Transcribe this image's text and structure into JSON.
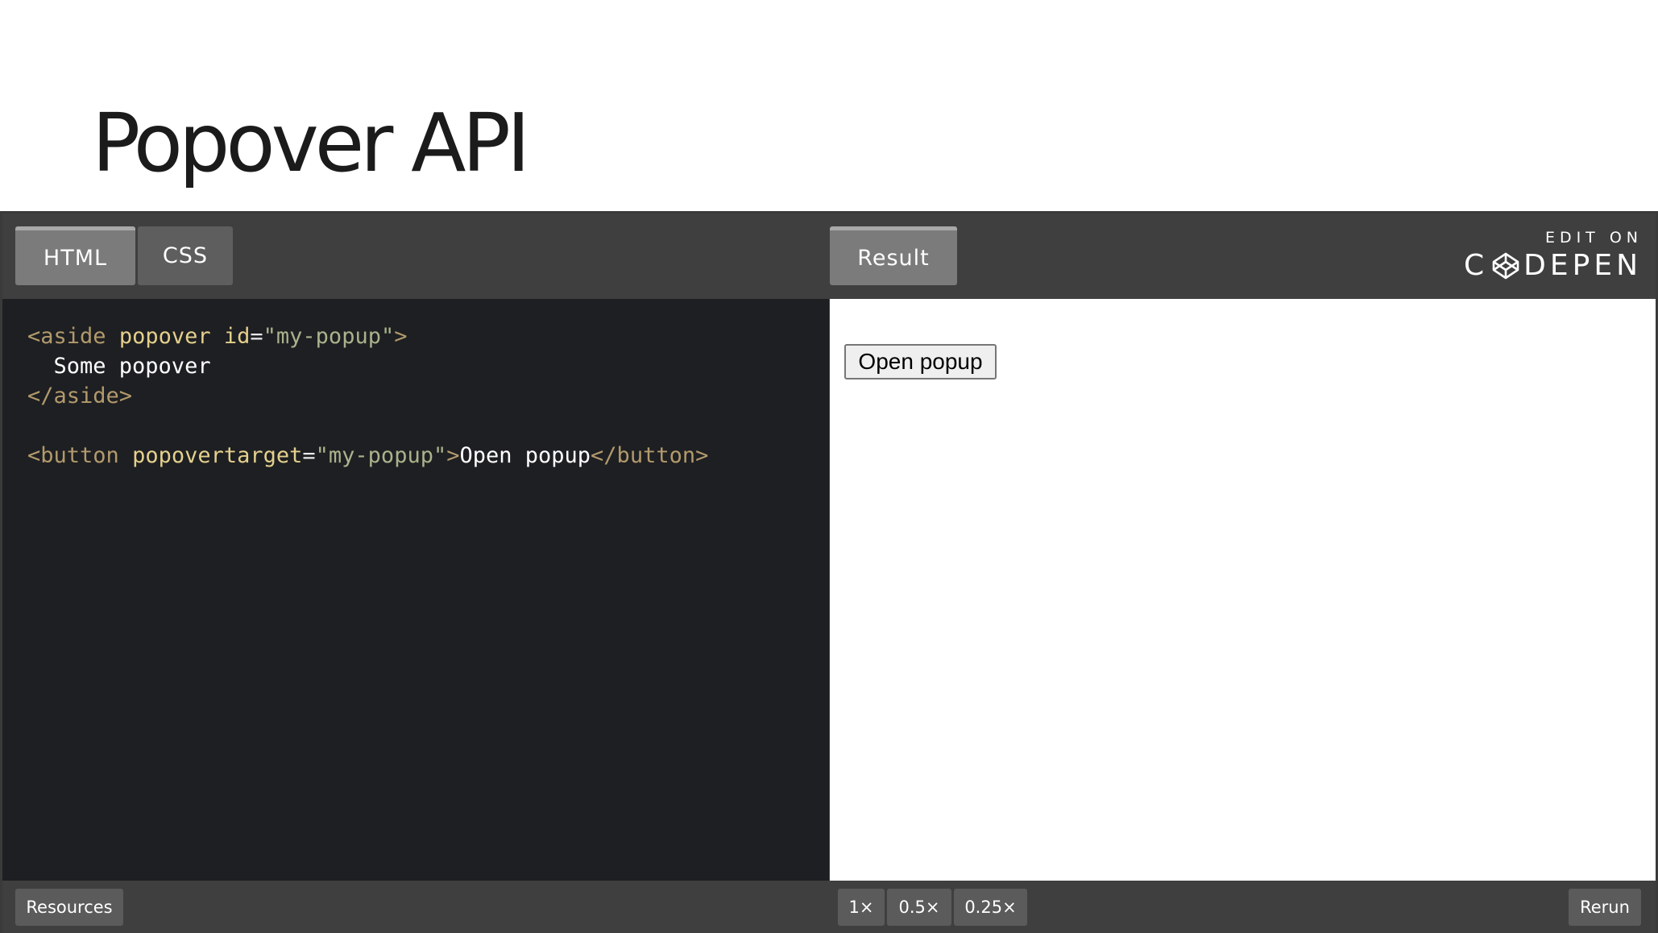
{
  "slide": {
    "title": "Popover API"
  },
  "embed": {
    "tabs": {
      "html": "HTML",
      "css": "CSS",
      "result": "Result"
    },
    "codepen_link": {
      "edit_on": "EDIT ON",
      "brand_left": "C",
      "brand_right": "DEPEN",
      "logo_icon": "codepen-cube-icon"
    },
    "code": {
      "line1": {
        "open": "<aside",
        "attr1": "popover",
        "attr2": "id",
        "eq": "=",
        "value": "\"my-popup\"",
        "close": ">"
      },
      "line2": {
        "text": "  Some popover"
      },
      "line3": {
        "tag": "</aside>"
      },
      "line5": {
        "open": "<button",
        "attr": "popovertarget",
        "eq": "=",
        "value": "\"my-popup\"",
        "close": ">",
        "text": "Open popup",
        "end_tag": "</button>"
      }
    },
    "result": {
      "button_label": "Open popup"
    },
    "footer": {
      "resources_label": "Resources",
      "zoom_options": [
        "1×",
        "0.5×",
        "0.25×"
      ],
      "rerun_label": "Rerun"
    },
    "colors": {
      "editor_bg": "#1e1f22",
      "chrome_bg": "#3f3f3f",
      "tag": "#b29a6c",
      "attribute": "#e4d08d",
      "string": "#a9b38c"
    }
  }
}
